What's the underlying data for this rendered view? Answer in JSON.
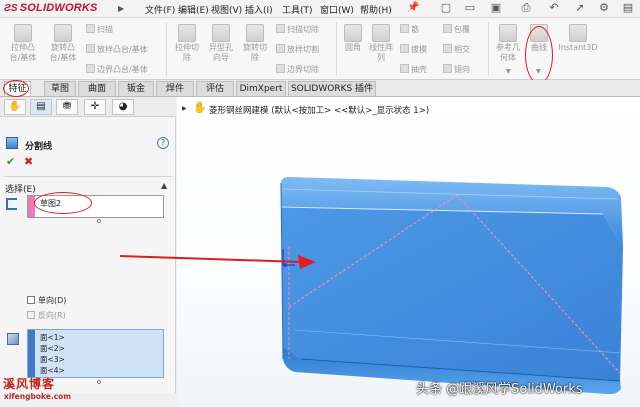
{
  "app": {
    "logo": "SOLIDWORKS",
    "menu": [
      "文件(F)",
      "编辑(E)",
      "视图(V)",
      "插入(I)",
      "工具(T)",
      "窗口(W)",
      "帮助(H)"
    ]
  },
  "ribbon": {
    "extrude_boss": "拉伸凸\n台/基体",
    "revolve_boss": "旋转凸\n台/基体",
    "sweep": "扫描",
    "loft_boss": "放样凸台/基体",
    "boundary_boss": "边界凸台/基体",
    "extrude_cut": "拉伸切\n除",
    "hole_wizard": "异型孔\n向导",
    "revolve_cut": "旋转切\n除",
    "sweep_cut": "扫描切除",
    "loft_cut": "放样切割",
    "boundary_cut": "边界切除",
    "fillet": "圆角",
    "linear_pattern": "线性阵\n列",
    "rib": "筋",
    "draft": "拔模",
    "shell": "抽壳",
    "wrap": "包覆",
    "intersect": "相交",
    "mirror": "镜向",
    "reference_geometry": "参考几\n何体",
    "curves": "曲线",
    "instant3d": "Instant3D"
  },
  "tabs": [
    "特征",
    "草图",
    "曲面",
    "钣金",
    "焊件",
    "评估",
    "DimXpert",
    "SOLIDWORKS 插件"
  ],
  "property_manager": {
    "feature_title": "分割线",
    "selection_section": "选择(E)",
    "sketch_selection": "草图2",
    "faces": [
      "面<1>",
      "面<2>",
      "面<3>",
      "面<4>"
    ],
    "single_direction": "单向(D)",
    "reverse": "反向(R)"
  },
  "feature_tree": {
    "root": "菱形钢丝网建模  (默认<按加工> <<默认>_显示状态 1>)"
  },
  "watermark": {
    "site_name": "溪风博客",
    "site_url": "xifengboke.com",
    "credit": "头条 @跟溪风学SolidWorks"
  },
  "colors": {
    "model_blue": "#3f8fe0",
    "highlight_red": "#e01c1c",
    "split_line_pink": "#e78fc0",
    "face_list_bg": "#cfe3f7"
  }
}
